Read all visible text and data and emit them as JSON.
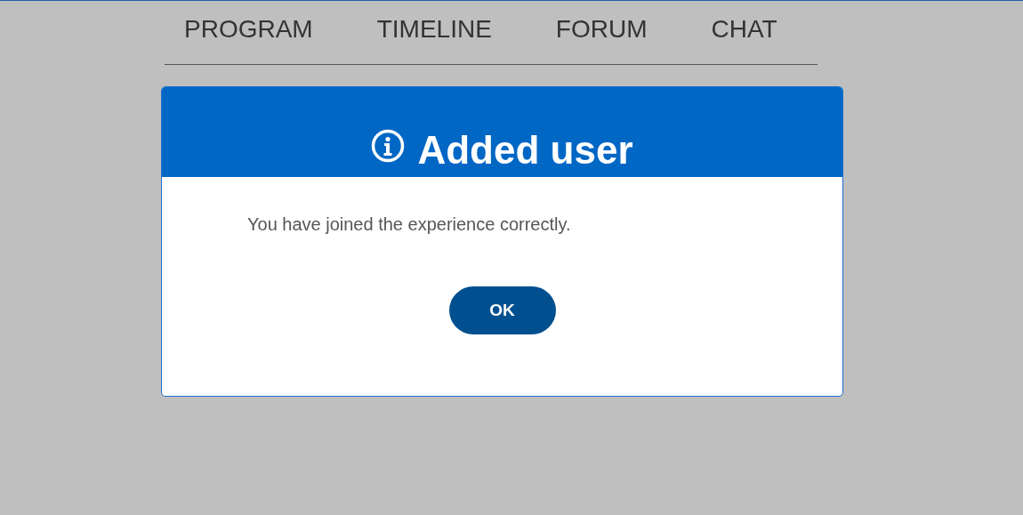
{
  "nav": {
    "tabs": [
      {
        "label": "PROGRAM"
      },
      {
        "label": "TIMELINE"
      },
      {
        "label": "FORUM"
      },
      {
        "label": "CHAT"
      }
    ]
  },
  "dialog": {
    "title": "Added user",
    "message": "You have joined the experience correctly.",
    "buttons": [
      "OK"
    ]
  }
}
